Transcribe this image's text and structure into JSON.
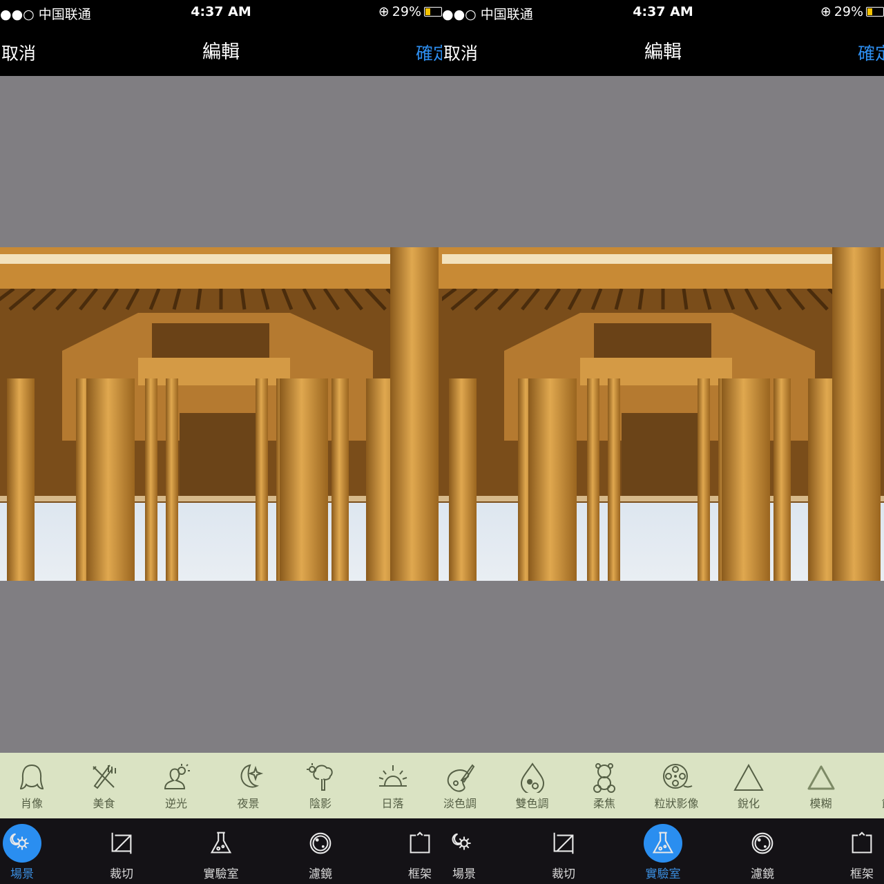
{
  "accent": "#2a8ef0",
  "panels": [
    {
      "status": {
        "carrier": "●●○ 中国联通",
        "time": "4:37 AM",
        "battery": "29%"
      },
      "nav": {
        "cancel": "取消",
        "title": "編輯",
        "confirm": "確定"
      },
      "tools": [
        {
          "label": "肖像",
          "icon": "portrait-icon"
        },
        {
          "label": "美食",
          "icon": "food-icon"
        },
        {
          "label": "逆光",
          "icon": "backlight-icon"
        },
        {
          "label": "夜景",
          "icon": "night-icon"
        },
        {
          "label": "陰影",
          "icon": "shade-icon"
        },
        {
          "label": "日落",
          "icon": "sunset-icon"
        },
        {
          "label": "淡色調",
          "icon": "palette-icon"
        }
      ],
      "tabs": [
        {
          "label": "場景",
          "icon": "scene-icon",
          "active": true
        },
        {
          "label": "裁切",
          "icon": "crop-icon",
          "active": false
        },
        {
          "label": "實驗室",
          "icon": "flask-icon",
          "active": false
        },
        {
          "label": "濾鏡",
          "icon": "filter-icon",
          "active": false
        },
        {
          "label": "框架",
          "icon": "frame-icon",
          "active": false
        }
      ]
    },
    {
      "status": {
        "carrier": "●●○ 中国联通",
        "time": "4:37 AM",
        "battery": "29%"
      },
      "nav": {
        "cancel": "取消",
        "title": "編輯",
        "confirm": "確定"
      },
      "tools": [
        {
          "label": "淡色調",
          "icon": "palette-icon"
        },
        {
          "label": "雙色調",
          "icon": "duotone-drop-icon"
        },
        {
          "label": "柔焦",
          "icon": "teddy-bear-icon"
        },
        {
          "label": "粒狀影像",
          "icon": "film-reel-icon"
        },
        {
          "label": "銳化",
          "icon": "triangle-icon"
        },
        {
          "label": "模糊",
          "icon": "blurred-triangle-icon"
        },
        {
          "label": "飽和",
          "icon": "crayon-icon"
        }
      ],
      "tabs": [
        {
          "label": "場景",
          "icon": "scene-icon",
          "active": false
        },
        {
          "label": "裁切",
          "icon": "crop-icon",
          "active": false
        },
        {
          "label": "實驗室",
          "icon": "flask-icon",
          "active": true
        },
        {
          "label": "濾鏡",
          "icon": "filter-icon",
          "active": false
        },
        {
          "label": "框架",
          "icon": "frame-icon",
          "active": false
        }
      ]
    }
  ]
}
